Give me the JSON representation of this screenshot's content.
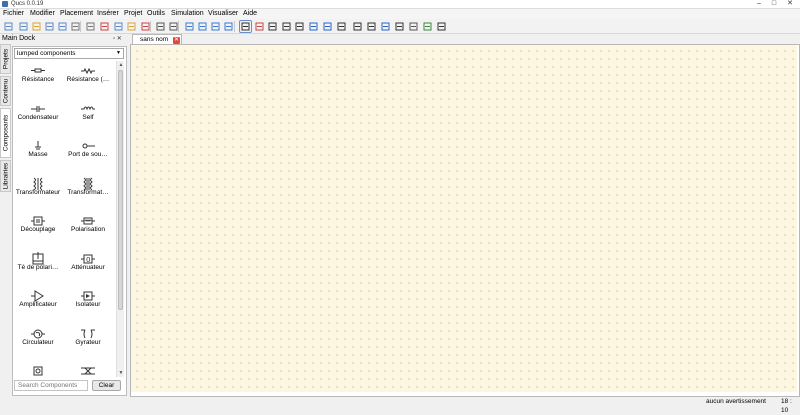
{
  "window": {
    "title": "Qucs 0.0.19",
    "controls": [
      "–",
      "□",
      "✕"
    ]
  },
  "menu": [
    "Fichier",
    "Modifier",
    "Placement",
    "Insérer",
    "Projet",
    "Outils",
    "Simulation",
    "Visualiser",
    "Aide"
  ],
  "toolbar": {
    "icons": [
      "new-file-icon",
      "new-text-icon",
      "open-icon",
      "save-icon",
      "save-all-icon",
      "close-doc-icon",
      "print-icon",
      "cut-icon",
      "copy-icon",
      "paste-icon",
      "delete-icon",
      "undo-icon",
      "redo-icon",
      "zoom-fit-icon",
      "zoom-icon",
      "zoom-in-icon",
      "zoom-out-icon",
      "select-icon",
      "deactivate-icon",
      "mirror-x-icon",
      "mirror-y-icon",
      "rotate-icon",
      "go-up-icon",
      "go-down-icon",
      "wire-icon",
      "label-icon",
      "equation-icon",
      "ground-icon",
      "port-icon",
      "simulate-icon",
      "view-data-icon",
      "marker-icon"
    ]
  },
  "dock": {
    "title": "Main Dock",
    "tabs": [
      "Projets",
      "Contenu",
      "Composants",
      "Librairies"
    ],
    "category": "lumped components",
    "components": [
      {
        "label": "Résistance",
        "icon": "resistor-icon"
      },
      {
        "label": "Résistance (…",
        "icon": "resistor-us-icon"
      },
      {
        "label": "Condensateur",
        "icon": "capacitor-icon"
      },
      {
        "label": "Self",
        "icon": "inductor-icon"
      },
      {
        "label": "Masse",
        "icon": "ground-icon"
      },
      {
        "label": "Port de sou…",
        "icon": "source-port-icon"
      },
      {
        "label": "Transformateur",
        "icon": "transformer-icon"
      },
      {
        "label": "Transformat…",
        "icon": "transformer-sym-icon"
      },
      {
        "label": "Découplage",
        "icon": "dc-block-icon"
      },
      {
        "label": "Polarisation",
        "icon": "dc-feed-icon"
      },
      {
        "label": "Té de polari…",
        "icon": "bias-tee-icon"
      },
      {
        "label": "Atténuateur",
        "icon": "attenuator-icon"
      },
      {
        "label": "Amplificateur",
        "icon": "amplifier-icon"
      },
      {
        "label": "Isolateur",
        "icon": "isolator-icon"
      },
      {
        "label": "Circulateur",
        "icon": "circulator-icon"
      },
      {
        "label": "Gyrateur",
        "icon": "gyrator-icon"
      },
      {
        "label": "",
        "icon": "phase-shifter-icon"
      },
      {
        "label": "",
        "icon": "coupler-icon"
      }
    ],
    "search_placeholder": "Search Components",
    "clear_label": "Clear"
  },
  "document": {
    "tab_label": "sans nom"
  },
  "status": {
    "warnings": "aucun avertissement",
    "position": "18 : 10"
  }
}
